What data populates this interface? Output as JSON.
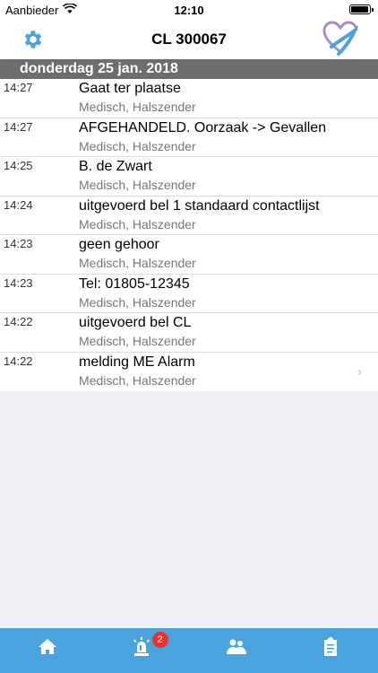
{
  "status": {
    "carrier": "Aanbieder",
    "time": "12:10",
    "battery_fraction": 0.95
  },
  "nav": {
    "title": "CL 300067"
  },
  "section": {
    "date": "donderdag 25 jan. 2018"
  },
  "events": [
    {
      "time": "14:27",
      "text": "Gaat ter plaatse",
      "sub": "Medisch, Halszender"
    },
    {
      "time": "14:27",
      "text": "AFGEHANDELD. Oorzaak -> Gevallen",
      "sub": "Medisch, Halszender"
    },
    {
      "time": "14:25",
      "text": "B. de Zwart",
      "sub": "Medisch, Halszender"
    },
    {
      "time": "14:24",
      "text": "uitgevoerd bel 1 standaard contactlijst",
      "sub": "Medisch, Halszender"
    },
    {
      "time": "14:23",
      "text": "geen gehoor",
      "sub": "Medisch, Halszender"
    },
    {
      "time": "14:23",
      "text": "Tel: 01805-12345",
      "sub": "Medisch, Halszender"
    },
    {
      "time": "14:22",
      "text": "uitgevoerd bel CL",
      "sub": "Medisch, Halszender"
    },
    {
      "time": "14:22",
      "text": "melding ME Alarm",
      "sub": "Medisch, Halszender"
    }
  ],
  "tabs": {
    "items": [
      {
        "icon": "home-icon"
      },
      {
        "icon": "alarm-light-icon",
        "badge": "2"
      },
      {
        "icon": "users-icon"
      },
      {
        "icon": "clipboard-icon"
      }
    ]
  },
  "colors": {
    "accent": "#4aa3dd",
    "header": "#6d6d6d",
    "badge": "#e8332f"
  }
}
